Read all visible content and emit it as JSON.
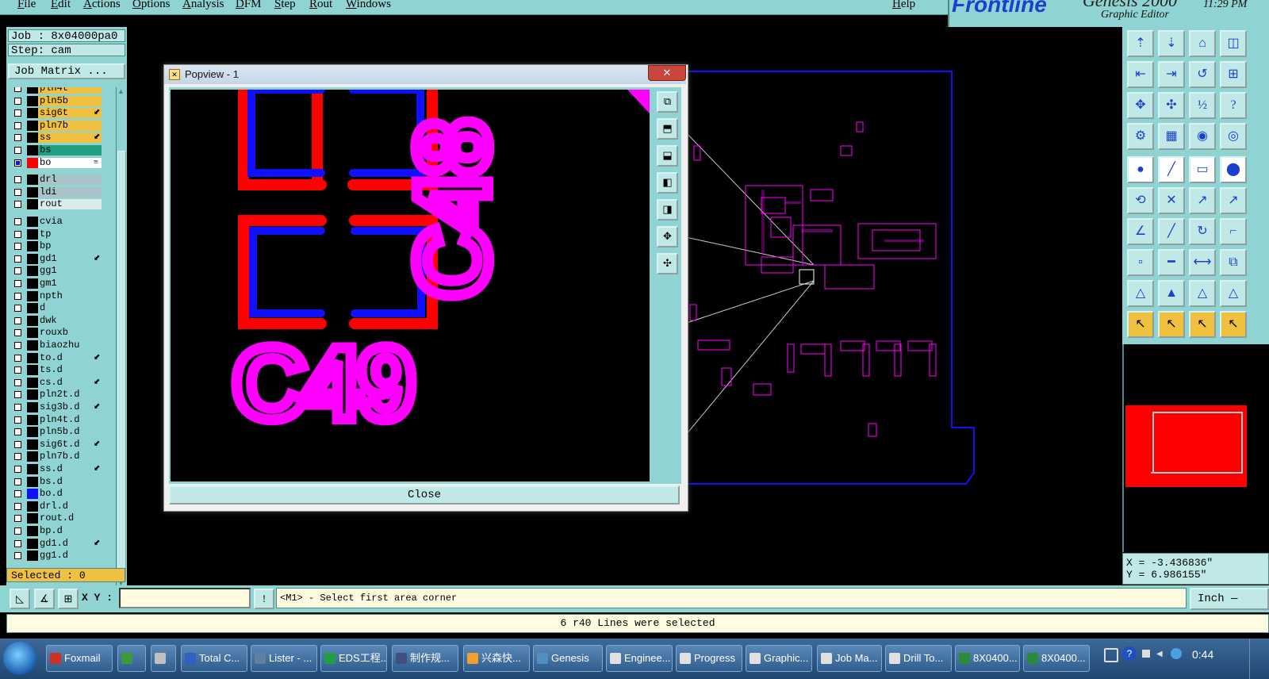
{
  "menubar": {
    "items": [
      "File",
      "Edit",
      "Actions",
      "Options",
      "Analysis",
      "DFM",
      "Step",
      "Rout",
      "Windows"
    ],
    "help": "Help"
  },
  "branding": {
    "logo": "Frontline",
    "logo_tail": "Genesis 2000",
    "subtitle": "Graphic Editor",
    "clock": "11:29 PM"
  },
  "job": {
    "job_label": "Job : 8x04000pa0",
    "step_label": "Step: cam",
    "job_matrix": "Job Matrix ..."
  },
  "layers": [
    {
      "name": "pln4t",
      "color": "#f0c040",
      "flag": ""
    },
    {
      "name": "pln5b",
      "color": "#f0c040",
      "flag": ""
    },
    {
      "name": "sig6t",
      "color": "#f0c040",
      "flag": "⬋"
    },
    {
      "name": "pln7b",
      "color": "#f0c040",
      "flag": ""
    },
    {
      "name": "ss",
      "color": "#f0c040",
      "flag": "⬋"
    },
    {
      "name": "bs",
      "color": "#20a080",
      "flag": ""
    },
    {
      "name": "bo",
      "color": "#ffffff",
      "flag": "≡",
      "active": true
    },
    {
      "name": "drl",
      "color": "#a9c4c8",
      "flag": ""
    },
    {
      "name": "ldi",
      "color": "#a9c4c8",
      "flag": ""
    },
    {
      "name": "rout",
      "color": "#d8ecec",
      "flag": ""
    },
    {
      "name": "cvia",
      "color": "#8fd4d2",
      "flag": ""
    },
    {
      "name": "tp",
      "color": "#8fd4d2",
      "flag": ""
    },
    {
      "name": "bp",
      "color": "#8fd4d2",
      "flag": ""
    },
    {
      "name": "gd1",
      "color": "#8fd4d2",
      "flag": "⬋"
    },
    {
      "name": "gg1",
      "color": "#8fd4d2",
      "flag": ""
    },
    {
      "name": "gm1",
      "color": "#8fd4d2",
      "flag": ""
    },
    {
      "name": "npth",
      "color": "#8fd4d2",
      "flag": ""
    },
    {
      "name": "d",
      "color": "#8fd4d2",
      "flag": ""
    },
    {
      "name": "dwk",
      "color": "#8fd4d2",
      "flag": ""
    },
    {
      "name": "rouxb",
      "color": "#8fd4d2",
      "flag": ""
    },
    {
      "name": "biaozhu",
      "color": "#8fd4d2",
      "flag": ""
    },
    {
      "name": "to.d",
      "color": "#8fd4d2",
      "flag": "⬋"
    },
    {
      "name": "ts.d",
      "color": "#8fd4d2",
      "flag": ""
    },
    {
      "name": "cs.d",
      "color": "#8fd4d2",
      "flag": "⬋"
    },
    {
      "name": "pln2t.d",
      "color": "#8fd4d2",
      "flag": ""
    },
    {
      "name": "sig3b.d",
      "color": "#8fd4d2",
      "flag": "⬋"
    },
    {
      "name": "pln4t.d",
      "color": "#8fd4d2",
      "flag": ""
    },
    {
      "name": "pln5b.d",
      "color": "#8fd4d2",
      "flag": ""
    },
    {
      "name": "sig6t.d",
      "color": "#8fd4d2",
      "flag": "⬋"
    },
    {
      "name": "pln7b.d",
      "color": "#8fd4d2",
      "flag": ""
    },
    {
      "name": "ss.d",
      "color": "#8fd4d2",
      "flag": "⬋"
    },
    {
      "name": "bs.d",
      "color": "#8fd4d2",
      "flag": ""
    },
    {
      "name": "bo.d",
      "color": "#8fd4d2",
      "flag": "",
      "blue": true
    },
    {
      "name": "drl.d",
      "color": "#8fd4d2",
      "flag": ""
    },
    {
      "name": "rout.d",
      "color": "#8fd4d2",
      "flag": ""
    },
    {
      "name": "bp.d",
      "color": "#8fd4d2",
      "flag": ""
    },
    {
      "name": "gd1.d",
      "color": "#8fd4d2",
      "flag": "⬋"
    },
    {
      "name": "gg1.d",
      "color": "#8fd4d2",
      "flag": ""
    }
  ],
  "selected": "Selected : 0",
  "popview": {
    "title": "Popview - 1",
    "close_x": "✕",
    "close_label": "Close",
    "label_top": "C48",
    "label_bottom": "C49"
  },
  "coords": {
    "x": "X = -3.436836\"",
    "y": "Y = 6.986155\""
  },
  "command": {
    "xy_label": "X Y :",
    "xy_value": "",
    "prompt": "<M1> - Select first area corner",
    "unit": "Inch —"
  },
  "status": "6 r40 Lines were selected",
  "taskbar": {
    "tasks": [
      {
        "label": "Foxmail",
        "color": "#d03020"
      },
      {
        "label": "",
        "color": "#3a9a3a"
      },
      {
        "label": "",
        "color": "#c0c0c0"
      },
      {
        "label": "Total C...",
        "color": "#3060c0"
      },
      {
        "label": "Lister - ...",
        "color": "#6080a0"
      },
      {
        "label": "EDS工程...",
        "color": "#20a040"
      },
      {
        "label": "制作规...",
        "color": "#405080"
      },
      {
        "label": "兴森快...",
        "color": "#f0a030"
      },
      {
        "label": "Genesis",
        "color": "#5090c0"
      },
      {
        "label": "Enginee...",
        "color": "#e0e0e0"
      },
      {
        "label": "Progress",
        "color": "#e0e0e0"
      },
      {
        "label": "Graphic...",
        "color": "#e0e0e0"
      },
      {
        "label": "Job Ma...",
        "color": "#e0e0e0"
      },
      {
        "label": "Drill To...",
        "color": "#e0e0e0"
      },
      {
        "label": "8X0400...",
        "color": "#2a8a3a"
      },
      {
        "label": "8X0400...",
        "color": "#2a8a3a"
      }
    ],
    "time": "0:44"
  },
  "colors": {
    "teal": "#8fd4d2",
    "magenta": "#ff00ff",
    "pad_red": "#ff0000",
    "pad_blue": "#1010ff",
    "board_outline": "#1010ff"
  }
}
